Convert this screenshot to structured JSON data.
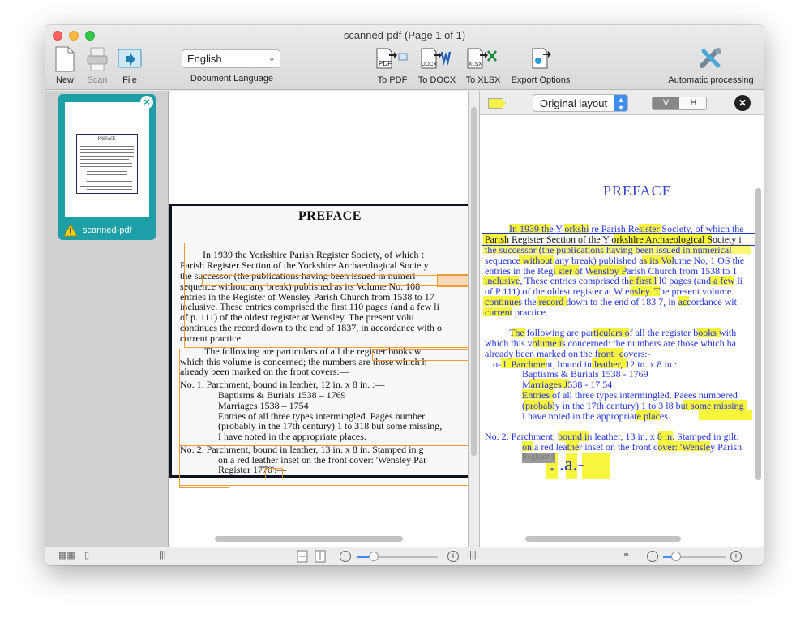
{
  "window": {
    "title": "scanned-pdf (Page 1 of 1)"
  },
  "toolbar": {
    "new_label": "New",
    "scan_label": "Scan",
    "file_label": "File",
    "language_value": "English",
    "language_label": "Document Language",
    "to_pdf_label": "To PDF",
    "to_docx_label": "To DOCX",
    "to_xlsx_label": "To XLSX",
    "export_options_label": "Export Options",
    "auto_processing_label": "Automatic processing",
    "pdf_badge": "PDF",
    "docx_badge": "DOCX",
    "xlsx_badge": "XLSX"
  },
  "sidebar": {
    "thumb_name": "scanned-pdf",
    "thumb_preview_title": "PREFACE"
  },
  "scan": {
    "title": "PREFACE",
    "lines": [
      "In 1939 the Yorkshire Parish Register Society, of which t",
      "Parish Register Section of the Yorkshire Archaeological Society",
      "the successor (the publications having been issued in numeri",
      "sequence without any break) published as its Volume No. 108",
      "entries in the Register of Wensley Parish Church from 1538 to 17",
      "inclusive.  These entries comprised the first 110 pages (and a few li",
      "of p. 111) of the oldest register at Wensley.  The present volu",
      "continues the record down to the end of 1837, in accordance with o",
      "current practice.",
      "The following are particulars of all the register books w",
      "which this volume is concerned; the numbers are those which h",
      "already been marked on the front covers:—",
      "No. 1.    Parchment, bound in leather, 12 in. x 8 in. :—",
      "Baptisms & Burials 1538 – 1769",
      "Marriages              1538 – 1754",
      "Entries of all three types intermingled.   Pages number",
      "(probably in the 17th century) 1 to 318 but some missing,",
      "I have noted in the appropriate places.",
      "No. 2.    Parchment, bound in leather, 13 in. x 8 in.  Stamped in g",
      "on a red leather inset on the front cover: 'Wensley Par",
      "Register 1770':—"
    ]
  },
  "rightpane": {
    "layout_value": "Original layout",
    "v_label": "V",
    "h_label": "H",
    "title": "PREFACE",
    "lines": [
      "In 1939 the Y orkshi re Parish Resister Society, of which the",
      "Parish Register Section of the Y orkshlre Archaeological Society i",
      "the successor (the publications having been issued in numerical",
      "sequence without any break) published as its Volume No, 1 OS the",
      "entries in the Regi ster of Wensloy Parish Church from 1538 to 1'",
      "inclusive, These entries comprised the first l l0 pages (and a few li",
      "of P 111) of the oldest register at W ensley. The present volume",
      "continues the record down to the end of 183 7, in accordance wit",
      "current practice.",
      "The following are particulars of all the register books with",
      "which this volume is concerned: the numbers are those which ha",
      "already been marked on the front· covers:-",
      "o- l. Parchment, bound in leather, 12 in. x 8 in.:",
      "Baptisms & Burials 1538 - 1769",
      "Marriages J538 - 17 54",
      "Entries of all three types intermingled. Paees numbered",
      "(probably in the 17th century) 1 to 3 l8 but some missing",
      "I have noted in the appropriate places.",
      "No. 2. Parchment, bound in leather, 13 in. x 8 in. Stamped in gilt.",
      "on a red leather inset on the front cover: 'Wensley Parish",
      "Register 1",
      ". .a.-"
    ]
  }
}
